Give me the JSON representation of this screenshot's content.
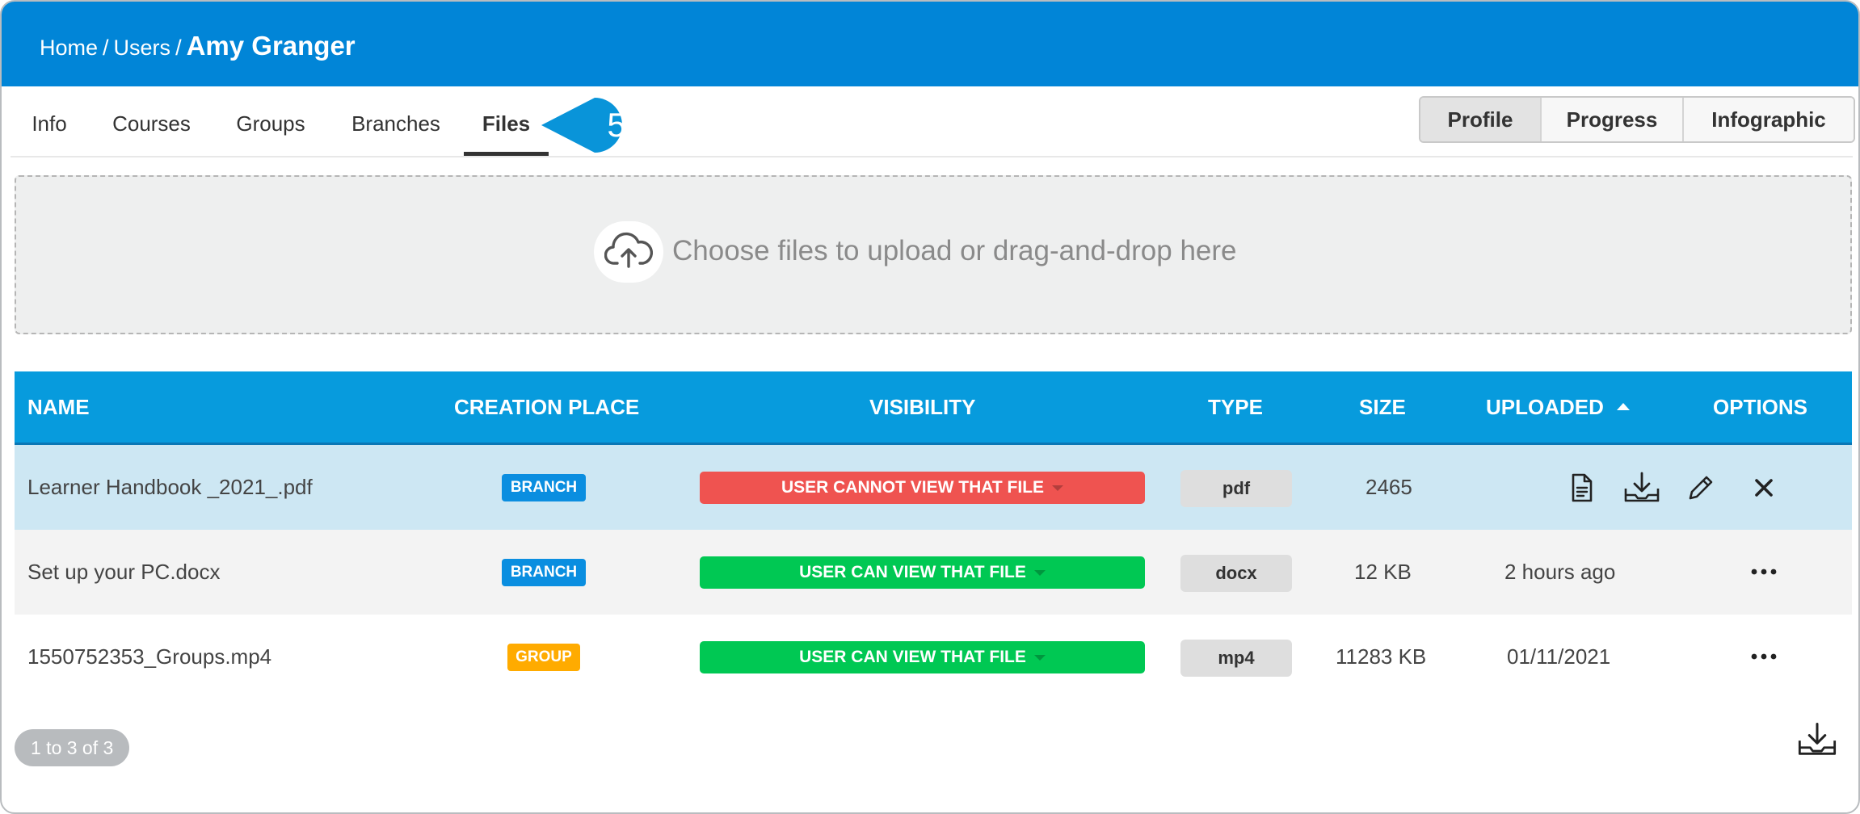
{
  "breadcrumb": {
    "home": "Home",
    "users": "Users",
    "current": "Amy Granger",
    "separator": "/"
  },
  "tabs": [
    {
      "label": "Info"
    },
    {
      "label": "Courses"
    },
    {
      "label": "Groups"
    },
    {
      "label": "Branches"
    },
    {
      "label": "Files",
      "active": true
    }
  ],
  "callout": {
    "number": "5",
    "color": "#0994d9"
  },
  "view_toggle": [
    {
      "label": "Profile",
      "selected": true
    },
    {
      "label": "Progress"
    },
    {
      "label": "Infographic"
    }
  ],
  "upload": {
    "text": "Choose files to upload or drag-and-drop here",
    "icon": "cloud-upload-icon"
  },
  "table": {
    "headers": {
      "name": "NAME",
      "creation_place": "CREATION PLACE",
      "visibility": "VISIBILITY",
      "type": "TYPE",
      "size": "SIZE",
      "uploaded": "UPLOADED",
      "options": "OPTIONS"
    },
    "sorted_by": "uploaded",
    "sort_direction": "ascending",
    "rows": [
      {
        "name": "Learner Handbook _2021_.pdf",
        "place": "BRANCH",
        "place_color": "#0a8ee0",
        "visibility": "USER CANNOT VIEW THAT FILE",
        "visibility_color": "#ef5350",
        "type": "pdf",
        "size": "2465",
        "uploaded": ""
      },
      {
        "name": "Set up your PC.docx",
        "place": "BRANCH",
        "place_color": "#0a8ee0",
        "visibility": "USER CAN VIEW THAT FILE",
        "visibility_color": "#00c853",
        "type": "docx",
        "size": "12 KB",
        "uploaded": "2 hours ago"
      },
      {
        "name": "1550752353_Groups.mp4",
        "place": "GROUP",
        "place_color": "#ffab00",
        "visibility": "USER CAN VIEW THAT FILE",
        "visibility_color": "#00c853",
        "type": "mp4",
        "size": "11283 KB",
        "uploaded": "01/11/2021"
      }
    ]
  },
  "pagination": {
    "text": "1 to 3 of 3"
  },
  "colors": {
    "header_bg": "#0185d7",
    "table_header_bg": "#079bdd",
    "selected_row_bg": "#cde7f3"
  }
}
